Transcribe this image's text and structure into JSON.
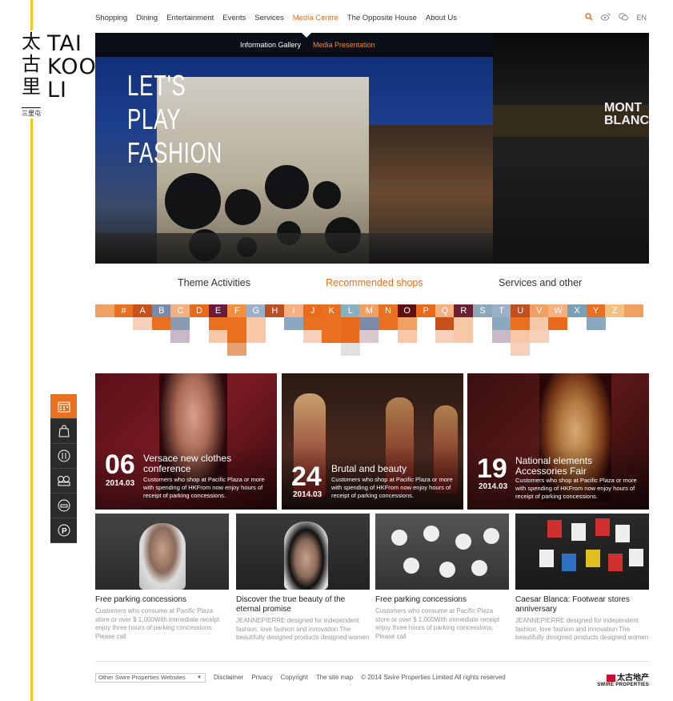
{
  "logo": {
    "cn_chars": [
      "太",
      "古",
      "里"
    ],
    "en_lines": [
      "TAI",
      "KOO",
      "LI"
    ],
    "sub": "三里屯"
  },
  "nav": {
    "items": [
      "Shopping",
      "Dining",
      "Entertainment",
      "Events",
      "Services",
      "Media Centre",
      "The Opposite House",
      "About Us"
    ],
    "active": "Media Centre",
    "lang": "EN",
    "icons": [
      "search-icon",
      "weibo-icon",
      "wechat-icon"
    ]
  },
  "hero": {
    "subnav": [
      "Information Gallery",
      "Media Presentation"
    ],
    "subnav_active": "Media Presentation",
    "slogan": [
      "LET'S",
      "PLAY",
      "FASHION"
    ],
    "sign": [
      "MONT",
      "BLANC"
    ]
  },
  "tabs": [
    "Theme Activities",
    "Recommended shops",
    "Services and other"
  ],
  "tabs_active": "Recommended shops",
  "alphabet": [
    "#",
    "A",
    "B",
    "C",
    "D",
    "E",
    "F",
    "G",
    "H",
    "I",
    "J",
    "K",
    "L",
    "M",
    "N",
    "O",
    "P",
    "Q",
    "R",
    "S",
    "T",
    "U",
    "V",
    "W",
    "X",
    "Y",
    "Z"
  ],
  "side_icons": [
    "calendar-icon",
    "shopping-bag-icon",
    "dining-icon",
    "film-icon",
    "car-icon",
    "parking-icon"
  ],
  "featured": [
    {
      "day": "06",
      "month": "2014.03",
      "title": "Versace new clothes conference",
      "desc": "Customers who shop at Pacific Plaza or more with spending of HKFrom now enjoy hours of receipt of parking concessions."
    },
    {
      "day": "24",
      "month": "2014.03",
      "title": "Brutal and beauty",
      "desc": "Customers who shop at Pacific Plaza or more with spending of HKFrom now enjoy hours of receipt of parking concessions."
    },
    {
      "day": "19",
      "month": "2014.03",
      "title": "National elements Accessories Fair",
      "desc": "Customers who shop at Pacific Plaza or more with spending of HKFrom now enjoy hours of receipt of parking concessions."
    }
  ],
  "news": [
    {
      "title": "Free parking concessions",
      "desc": "Customers who consume at Pacific Plaza store or over $ 1,000With immediate receipt enjoy three hours of parking concessions. Please call"
    },
    {
      "title": "Discover the true beauty of the eternal promise",
      "desc": "JEANNEPIERRE designed for independent fashion, love fashion and innovation The beautifully designed products designed women"
    },
    {
      "title": "Free parking concessions",
      "desc": "Customers who consume at Pacific Plaza store or over $ 1,000With immediate receipt enjoy three hours of parking concessions. Please call"
    },
    {
      "title": "Caesar Blanca: Footwear stores anniversary",
      "desc": "JEANNEPIERRE designed for independent fashion, love fashion and innovation The beautifully designed products designed women"
    }
  ],
  "footer": {
    "select": "Other Swire Properties Websites",
    "links": [
      "Disclaimer",
      "Privacy",
      "Copyright",
      "The site map"
    ],
    "copyright": "© 2014 Swire Properties Limited All rights reserved",
    "brand_cn": "太古地产",
    "brand_en": "SWIRE PROPERTIES"
  },
  "colors": {
    "accent": "#e8701e",
    "line": "#f5c518"
  }
}
